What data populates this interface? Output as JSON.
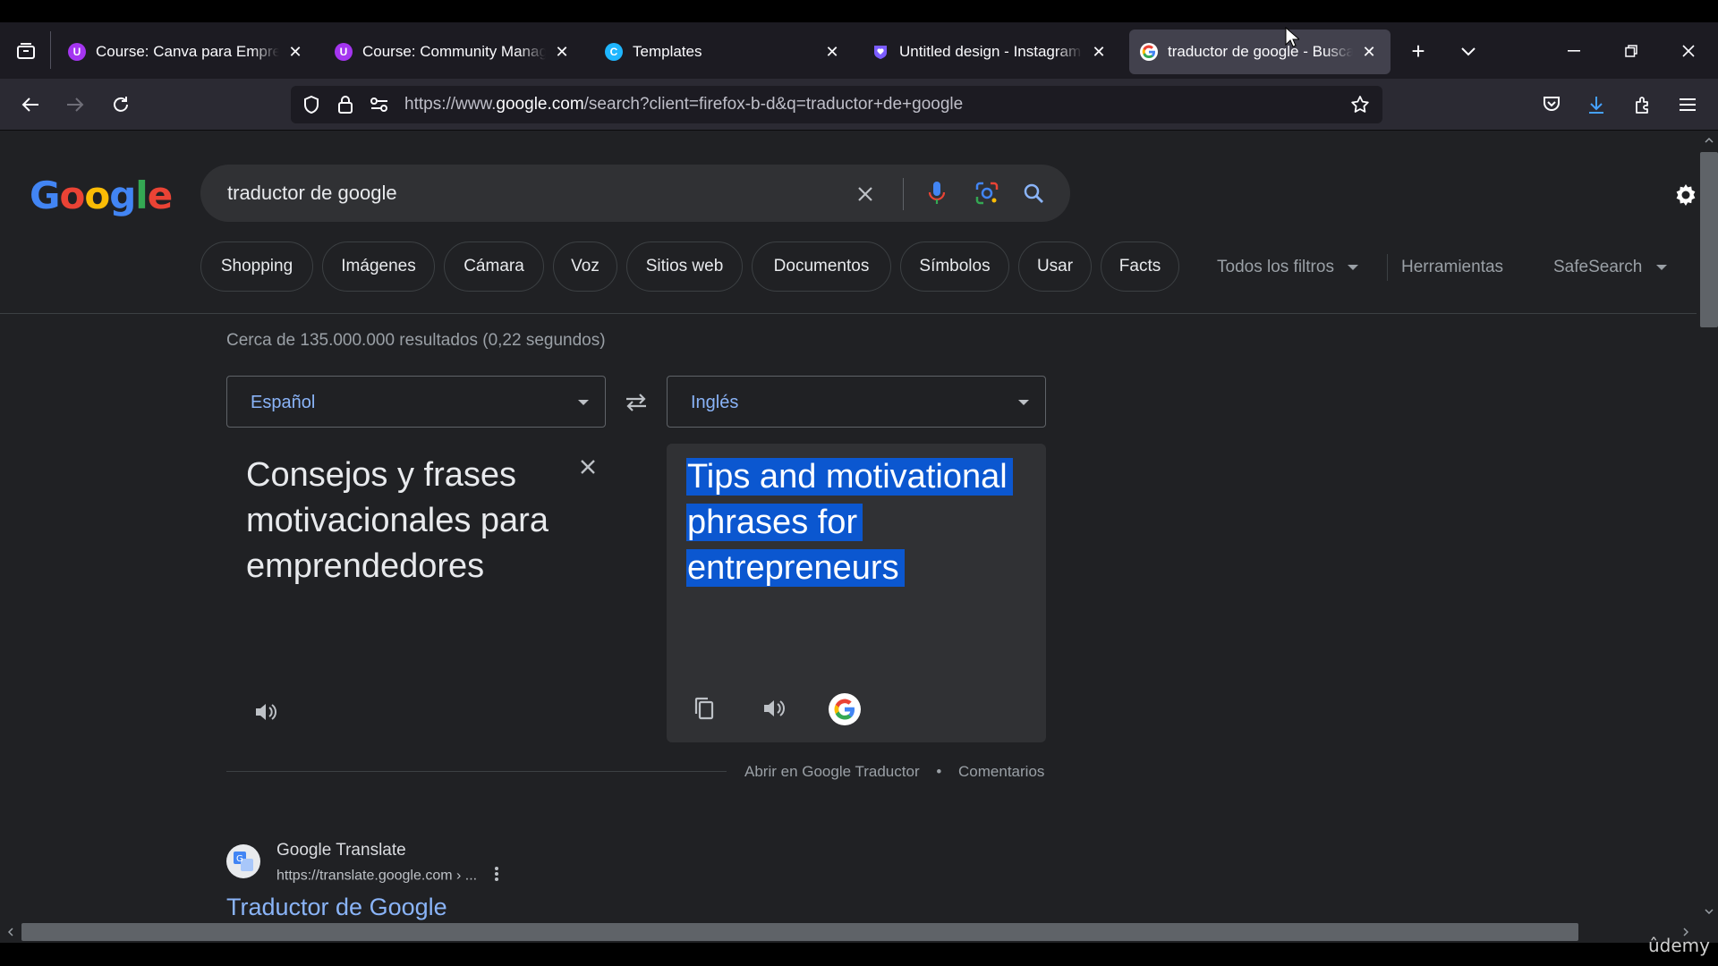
{
  "browser": {
    "tabs": [
      {
        "title": "Course: Canva para Emprendedores",
        "favicon": "udemy-icon",
        "color": "#a435f0"
      },
      {
        "title": "Course: Community Manager",
        "favicon": "udemy-icon",
        "color": "#a435f0"
      },
      {
        "title": "Templates",
        "favicon": "canva-icon",
        "color": "#1fb6ff"
      },
      {
        "title": "Untitled design - Instagram Post",
        "favicon": "heart-shield-icon",
        "color": "#7b5cff"
      },
      {
        "title": "traductor de google - Buscar",
        "favicon": "google-icon",
        "color": "#4285f4",
        "active": true
      }
    ],
    "url_prefix": "https://www.",
    "url_domain": "google.com",
    "url_path": "/search?client=firefox-b-d&q=traductor+de+google"
  },
  "search": {
    "logo": "Google",
    "query": "traductor de google",
    "chips": [
      "Shopping",
      "Imágenes",
      "Cámara",
      "Voz",
      "Sitios web",
      "Documentos",
      "Símbolos",
      "Usar",
      "Facts"
    ],
    "filters": [
      "Todos los filtros",
      "Herramientas",
      "SafeSearch"
    ],
    "stats": "Cerca de 135.000.000 resultados (0,22 segundos)"
  },
  "translate": {
    "source_lang": "Español",
    "target_lang": "Inglés",
    "source_text": "Consejos y frases motivacionales para emprendedores",
    "target_lines": [
      "Tips and motivational",
      "phrases for",
      "entrepreneurs"
    ],
    "open_link": "Abrir en Google Traductor",
    "separator": "•",
    "feedback_link": "Comentarios"
  },
  "result": {
    "site": "Google Translate",
    "url": "https://translate.google.com › ...",
    "title": "Traductor de Google"
  },
  "watermark": "ûdemy",
  "colors": {
    "accent": "#8ab4f8",
    "highlight": "#0b57d0",
    "bg": "#202124"
  }
}
